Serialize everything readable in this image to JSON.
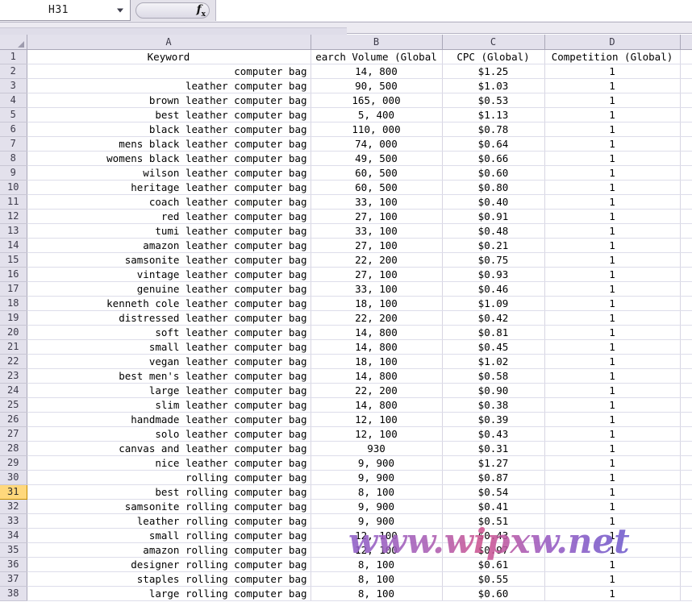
{
  "formula_bar": {
    "name_box_value": "H31",
    "formula_value": "",
    "fx_label": "fx",
    "dropdown_icon": "chevron-down-icon"
  },
  "grid": {
    "corner_icon": "select-all-corner-icon",
    "active_row": 31,
    "column_headers": [
      "A",
      "B",
      "C",
      "D"
    ],
    "header_row": {
      "row_number": 1,
      "cells": [
        "Keyword",
        "earch Volume (Global",
        "CPC (Global)",
        "Competition (Global)"
      ]
    },
    "row_numbers": [
      2,
      3,
      4,
      5,
      6,
      7,
      8,
      9,
      10,
      11,
      12,
      13,
      14,
      15,
      16,
      17,
      18,
      19,
      20,
      21,
      22,
      23,
      24,
      25,
      26,
      27,
      28,
      29,
      30,
      31,
      32,
      33,
      34,
      35,
      36,
      37,
      38
    ],
    "rows": [
      {
        "n": 2,
        "keyword": "computer bag",
        "volume": "14, 800",
        "cpc": "$1.25",
        "competition": "1"
      },
      {
        "n": 3,
        "keyword": "leather computer bag",
        "volume": "90, 500",
        "cpc": "$1.03",
        "competition": "1"
      },
      {
        "n": 4,
        "keyword": "brown leather computer bag",
        "volume": "165, 000",
        "cpc": "$0.53",
        "competition": "1"
      },
      {
        "n": 5,
        "keyword": "best leather computer bag",
        "volume": "5, 400",
        "cpc": "$1.13",
        "competition": "1"
      },
      {
        "n": 6,
        "keyword": "black leather computer bag",
        "volume": "110, 000",
        "cpc": "$0.78",
        "competition": "1"
      },
      {
        "n": 7,
        "keyword": "mens black leather computer bag",
        "volume": "74, 000",
        "cpc": "$0.64",
        "competition": "1"
      },
      {
        "n": 8,
        "keyword": "womens black leather computer bag",
        "volume": "49, 500",
        "cpc": "$0.66",
        "competition": "1"
      },
      {
        "n": 9,
        "keyword": "wilson leather computer bag",
        "volume": "60, 500",
        "cpc": "$0.60",
        "competition": "1"
      },
      {
        "n": 10,
        "keyword": "heritage leather computer bag",
        "volume": "60, 500",
        "cpc": "$0.80",
        "competition": "1"
      },
      {
        "n": 11,
        "keyword": "coach leather computer bag",
        "volume": "33, 100",
        "cpc": "$0.40",
        "competition": "1"
      },
      {
        "n": 12,
        "keyword": "red leather computer bag",
        "volume": "27, 100",
        "cpc": "$0.91",
        "competition": "1"
      },
      {
        "n": 13,
        "keyword": "tumi leather computer bag",
        "volume": "33, 100",
        "cpc": "$0.48",
        "competition": "1"
      },
      {
        "n": 14,
        "keyword": "amazon leather computer bag",
        "volume": "27, 100",
        "cpc": "$0.21",
        "competition": "1"
      },
      {
        "n": 15,
        "keyword": "samsonite leather computer bag",
        "volume": "22, 200",
        "cpc": "$0.75",
        "competition": "1"
      },
      {
        "n": 16,
        "keyword": "vintage leather computer bag",
        "volume": "27, 100",
        "cpc": "$0.93",
        "competition": "1"
      },
      {
        "n": 17,
        "keyword": "genuine leather computer bag",
        "volume": "33, 100",
        "cpc": "$0.46",
        "competition": "1"
      },
      {
        "n": 18,
        "keyword": "kenneth cole leather computer bag",
        "volume": "18, 100",
        "cpc": "$1.09",
        "competition": "1"
      },
      {
        "n": 19,
        "keyword": "distressed leather computer bag",
        "volume": "22, 200",
        "cpc": "$0.42",
        "competition": "1"
      },
      {
        "n": 20,
        "keyword": "soft leather computer bag",
        "volume": "14, 800",
        "cpc": "$0.81",
        "competition": "1"
      },
      {
        "n": 21,
        "keyword": "small leather computer bag",
        "volume": "14, 800",
        "cpc": "$0.45",
        "competition": "1"
      },
      {
        "n": 22,
        "keyword": "vegan leather computer bag",
        "volume": "18, 100",
        "cpc": "$1.02",
        "competition": "1"
      },
      {
        "n": 23,
        "keyword": "best men's leather computer bag",
        "volume": "14, 800",
        "cpc": "$0.58",
        "competition": "1"
      },
      {
        "n": 24,
        "keyword": "large leather computer bag",
        "volume": "22, 200",
        "cpc": "$0.90",
        "competition": "1"
      },
      {
        "n": 25,
        "keyword": "slim leather computer bag",
        "volume": "14, 800",
        "cpc": "$0.38",
        "competition": "1"
      },
      {
        "n": 26,
        "keyword": "handmade leather computer bag",
        "volume": "12, 100",
        "cpc": "$0.39",
        "competition": "1"
      },
      {
        "n": 27,
        "keyword": "solo leather computer bag",
        "volume": "12, 100",
        "cpc": "$0.43",
        "competition": "1"
      },
      {
        "n": 28,
        "keyword": "canvas and leather computer bag",
        "volume": "930",
        "cpc": "$0.31",
        "competition": "1"
      },
      {
        "n": 29,
        "keyword": "nice leather computer bag",
        "volume": "9, 900",
        "cpc": "$1.27",
        "competition": "1"
      },
      {
        "n": 30,
        "keyword": "rolling computer bag",
        "volume": "9, 900",
        "cpc": "$0.87",
        "competition": "1"
      },
      {
        "n": 31,
        "keyword": "best rolling computer bag",
        "volume": "8, 100",
        "cpc": "$0.54",
        "competition": "1"
      },
      {
        "n": 32,
        "keyword": "samsonite rolling computer bag",
        "volume": "9, 900",
        "cpc": "$0.41",
        "competition": "1"
      },
      {
        "n": 33,
        "keyword": "leather rolling computer bag",
        "volume": "9, 900",
        "cpc": "$0.51",
        "competition": "1"
      },
      {
        "n": 34,
        "keyword": "small rolling computer bag",
        "volume": "12, 100",
        "cpc": "$0.43",
        "competition": "1"
      },
      {
        "n": 35,
        "keyword": "amazon rolling computer bag",
        "volume": "12, 100",
        "cpc": "$0.97",
        "competition": "1"
      },
      {
        "n": 36,
        "keyword": "designer rolling computer bag",
        "volume": "8, 100",
        "cpc": "$0.61",
        "competition": "1"
      },
      {
        "n": 37,
        "keyword": "staples rolling computer bag",
        "volume": "8, 100",
        "cpc": "$0.55",
        "competition": "1"
      },
      {
        "n": 38,
        "keyword": "large rolling computer bag",
        "volume": "8, 100",
        "cpc": "$0.60",
        "competition": "1"
      }
    ]
  },
  "watermark": {
    "text": "www.wipxw.net",
    "color_left": "#8b5fc4",
    "color_mid": "#c4559e",
    "color_right": "#7b5ec9"
  },
  "colors": {
    "header_bg": "#e3e1ec",
    "active_row_bg": "#ffd87c",
    "grid_line": "#ddddea",
    "chrome_bg": "#eceaf1"
  }
}
